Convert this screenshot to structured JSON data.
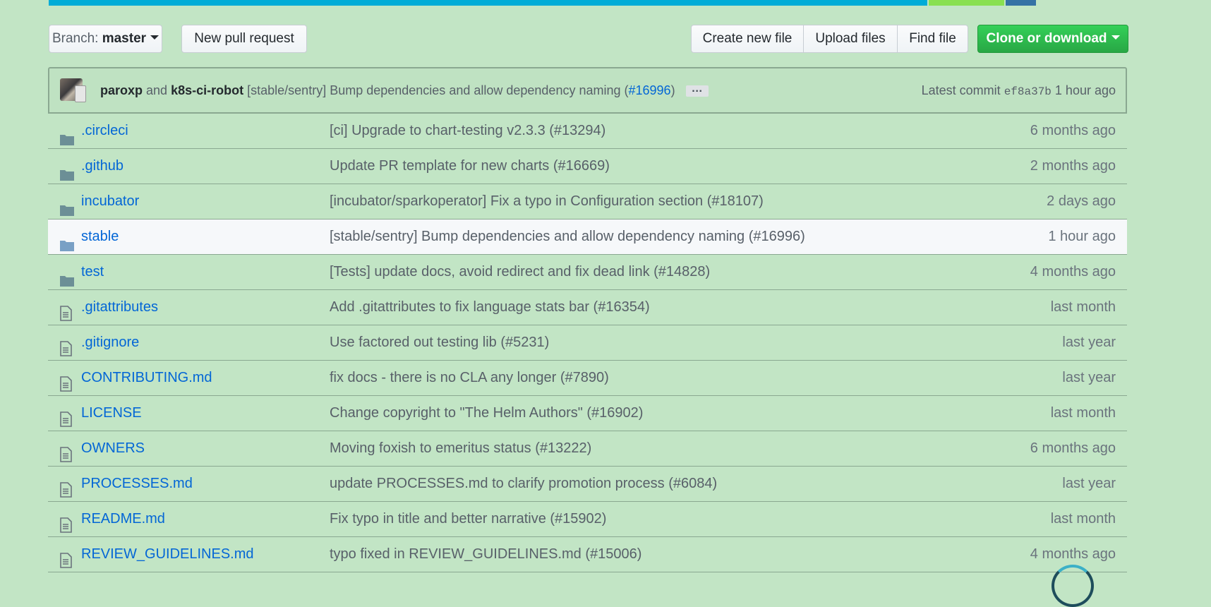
{
  "colors": {
    "language_bar": [
      "#00acd7",
      "#89e051",
      "#3572a5"
    ]
  },
  "language_bar_fractions": [
    0.815,
    0.07,
    0.028
  ],
  "toolbar": {
    "branch_prefix": "Branch:",
    "branch_name": "master",
    "new_pull_request": "New pull request",
    "create_new_file": "Create new file",
    "upload_files": "Upload files",
    "find_file": "Find file",
    "clone_or_download": "Clone or download"
  },
  "latest_commit": {
    "author1": "paroxp",
    "joiner": "and",
    "author2": "k8s-ci-robot",
    "message_prefix": "[stable/sentry] Bump dependencies and allow dependency naming (",
    "pr_link": "#16996",
    "message_suffix": ")",
    "ellipsis": "…",
    "label": "Latest commit",
    "sha": "ef8a37b",
    "age": "1 hour ago"
  },
  "files": [
    {
      "type": "dir",
      "icon": "folder-icon",
      "name": ".circleci",
      "message": "[ci] Upgrade to chart-testing v2.3.3 (#13294)",
      "age": "6 months ago"
    },
    {
      "type": "dir",
      "icon": "folder-icon",
      "name": ".github",
      "message": "Update PR template for new charts (#16669)",
      "age": "2 months ago"
    },
    {
      "type": "dir",
      "icon": "folder-icon",
      "name": "incubator",
      "message": "[incubator/sparkoperator] Fix a typo in Configuration section (#18107)",
      "age": "2 days ago"
    },
    {
      "type": "dir",
      "icon": "folder-icon",
      "name": "stable",
      "message": "[stable/sentry] Bump dependencies and allow dependency naming (#16996)",
      "age": "1 hour ago",
      "highlighted": true
    },
    {
      "type": "dir",
      "icon": "folder-icon",
      "name": "test",
      "message": "[Tests] update docs, avoid redirect and fix dead link (#14828)",
      "age": "4 months ago"
    },
    {
      "type": "file",
      "icon": "file-icon",
      "name": ".gitattributes",
      "message": "Add .gitattributes to fix language stats bar (#16354)",
      "age": "last month"
    },
    {
      "type": "file",
      "icon": "file-icon",
      "name": ".gitignore",
      "message": "Use factored out testing lib (#5231)",
      "age": "last year"
    },
    {
      "type": "file",
      "icon": "file-icon",
      "name": "CONTRIBUTING.md",
      "message": "fix docs - there is no CLA any longer (#7890)",
      "age": "last year"
    },
    {
      "type": "file",
      "icon": "file-icon",
      "name": "LICENSE",
      "message": "Change copyright to \"The Helm Authors\" (#16902)",
      "age": "last month"
    },
    {
      "type": "file",
      "icon": "file-icon",
      "name": "OWNERS",
      "message": "Moving foxish to emeritus status (#13222)",
      "age": "6 months ago"
    },
    {
      "type": "file",
      "icon": "file-icon",
      "name": "PROCESSES.md",
      "message": "update PROCESSES.md to clarify promotion process (#6084)",
      "age": "last year"
    },
    {
      "type": "file",
      "icon": "file-icon",
      "name": "README.md",
      "message": "Fix typo in title and better narrative (#15902)",
      "age": "last month"
    },
    {
      "type": "file",
      "icon": "file-icon",
      "name": "REVIEW_GUIDELINES.md",
      "message": "typo fixed in REVIEW_GUIDELINES.md (#15006)",
      "age": "4 months ago"
    }
  ]
}
